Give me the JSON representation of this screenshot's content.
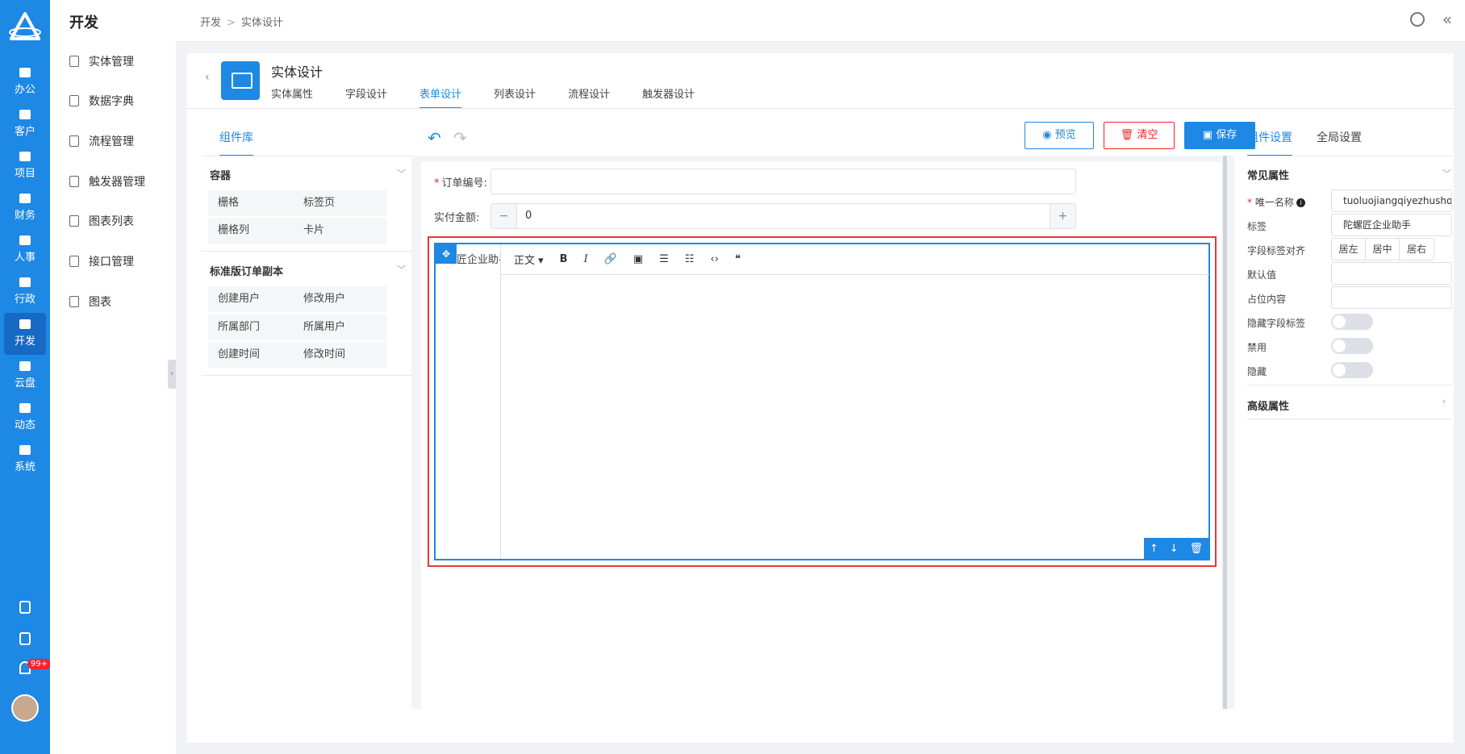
{
  "rail": {
    "items": [
      {
        "label": "办公"
      },
      {
        "label": "客户"
      },
      {
        "label": "项目"
      },
      {
        "label": "财务"
      },
      {
        "label": "人事"
      },
      {
        "label": "行政"
      },
      {
        "label": "开发"
      },
      {
        "label": "云盘"
      },
      {
        "label": "动态"
      },
      {
        "label": "系统"
      }
    ],
    "active": "开发",
    "notification_badge": "99+"
  },
  "sidebar": {
    "title": "开发",
    "items": [
      {
        "label": "实体管理",
        "icon": "form-icon"
      },
      {
        "label": "数据字典",
        "icon": "book-icon"
      },
      {
        "label": "流程管理",
        "icon": "list-icon"
      },
      {
        "label": "触发器管理",
        "icon": "form-icon"
      },
      {
        "label": "图表列表",
        "icon": "chart-icon"
      },
      {
        "label": "接口管理",
        "icon": "form-icon"
      },
      {
        "label": "图表",
        "icon": "printer-icon"
      }
    ]
  },
  "header": {
    "breadcrumb": [
      "开发",
      "实体设计"
    ]
  },
  "entity": {
    "title": "实体设计",
    "tabs": [
      "实体属性",
      "字段设计",
      "表单设计",
      "列表设计",
      "流程设计",
      "触发器设计"
    ],
    "active_tab": "表单设计"
  },
  "library": {
    "tab": "组件库",
    "groups": [
      {
        "title": "容器",
        "items": [
          "栅格",
          "标签页",
          "栅格列",
          "卡片"
        ]
      },
      {
        "title": "标准版订单副本",
        "items": [
          "创建用户",
          "修改用户",
          "所属部门",
          "所属用户",
          "创建时间",
          "修改时间"
        ]
      }
    ]
  },
  "toolbar": {
    "preview_label": "预览",
    "clear_label": "清空",
    "save_label": "保存"
  },
  "form": {
    "order_no_label": "订单编号:",
    "amount_label": "实付金额:",
    "amount_value": "0",
    "editor_label": "陀螺匠企业助手",
    "editor_tools": [
      "正文 ▾",
      "B",
      "I",
      "🔗",
      "▣",
      "☰",
      "☷",
      "‹›",
      "❝"
    ],
    "editor_actions": [
      "↑",
      "↓",
      "🗑"
    ]
  },
  "settings": {
    "tabs": [
      "组件设置",
      "全局设置"
    ],
    "common_section": "常见属性",
    "unique_name_label": "唯一名称",
    "unique_name_value": "tuoluojiangqiyezhushou",
    "label_label": "标签",
    "label_value": "陀螺匠企业助手",
    "align_label": "字段标签对齐",
    "align_options": [
      "居左",
      "居中",
      "居右"
    ],
    "default_label": "默认值",
    "placeholder_label": "占位内容",
    "hide_label_label": "隐藏字段标签",
    "disabled_label": "禁用",
    "hidden_label": "隐藏",
    "advanced_section": "高级属性"
  },
  "colors": {
    "primary": "#1e88e5",
    "danger": "#f5222d",
    "highlight": "#e53935"
  }
}
